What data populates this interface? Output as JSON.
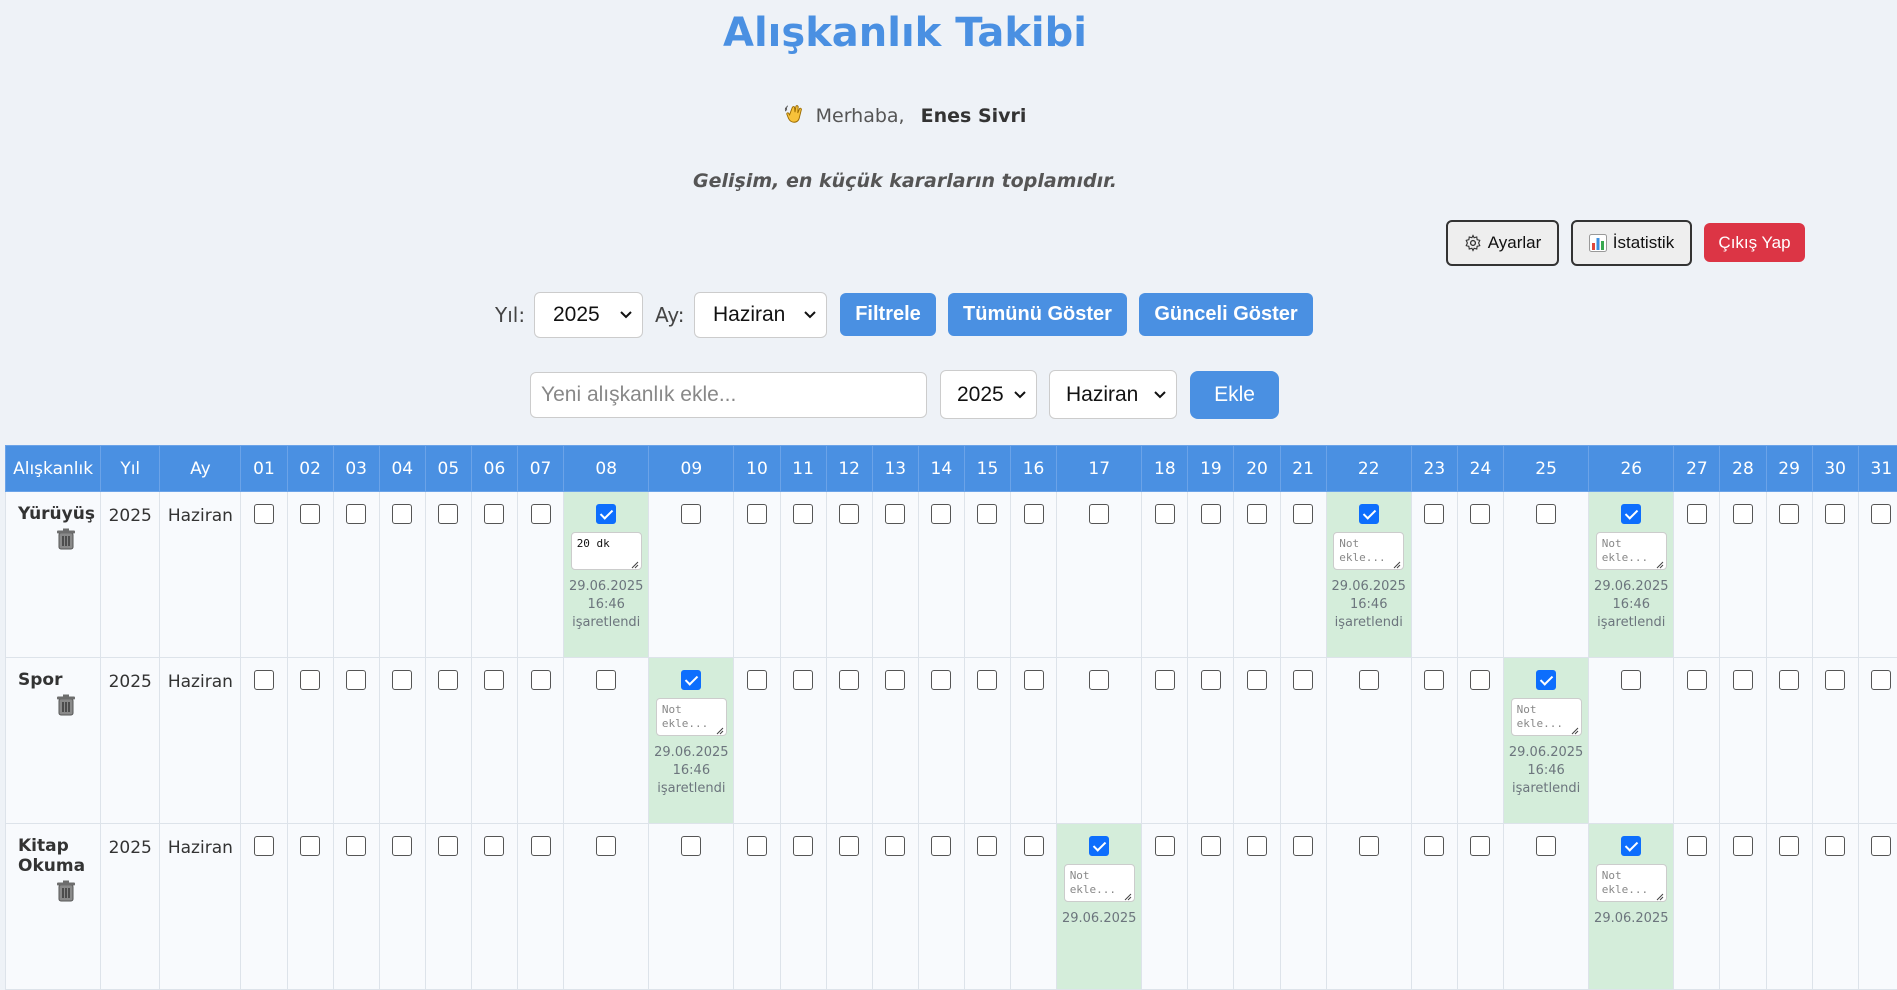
{
  "header": {
    "title": "Alışkanlık Takibi",
    "greeting": "Merhaba,",
    "user_name": "Enes Sivri",
    "quote": "Gelişim, en küçük kararların toplamıdır."
  },
  "toolbar": {
    "settings_label": "Ayarlar",
    "stats_label": "İstatistik",
    "logout_label": "Çıkış Yap"
  },
  "filter": {
    "year_label": "Yıl:",
    "year_value": "2025",
    "month_label": "Ay:",
    "month_value": "Haziran",
    "filter_label": "Filtrele",
    "show_all_label": "Tümünü Göster",
    "show_current_label": "Günceli Göster"
  },
  "add_form": {
    "placeholder": "Yeni alışkanlık ekle...",
    "year_value": "2025",
    "month_value": "Haziran",
    "add_label": "Ekle"
  },
  "table": {
    "headers": [
      "Alışkanlık",
      "Yıl",
      "Ay",
      "01",
      "02",
      "03",
      "04",
      "05",
      "06",
      "07",
      "08",
      "09",
      "10",
      "11",
      "12",
      "13",
      "14",
      "15",
      "16",
      "17",
      "18",
      "19",
      "20",
      "21",
      "22",
      "23",
      "24",
      "25",
      "26",
      "27",
      "28",
      "29",
      "30",
      "31"
    ],
    "rows": [
      {
        "habit": "Yürüyüş",
        "year": "2025",
        "month": "Haziran",
        "checked": {
          "08": {
            "note": "20 dk",
            "date": "29.06.2025",
            "time": "16:46",
            "status": "işaretlendi"
          },
          "22": {
            "note": "",
            "date": "29.06.2025",
            "time": "16:46",
            "status": "işaretlendi"
          },
          "26": {
            "note": "",
            "date": "29.06.2025",
            "time": "16:46",
            "status": "işaretlendi"
          }
        }
      },
      {
        "habit": "Spor",
        "year": "2025",
        "month": "Haziran",
        "checked": {
          "09": {
            "note": "",
            "date": "29.06.2025",
            "time": "16:46",
            "status": "işaretlendi"
          },
          "25": {
            "note": "",
            "date": "29.06.2025",
            "time": "16:46",
            "status": "işaretlendi"
          }
        }
      },
      {
        "habit": "Kitap Okuma",
        "year": "2025",
        "month": "Haziran",
        "checked": {
          "17": {
            "note": "",
            "date": "29.06.2025",
            "time": "",
            "status": ""
          },
          "26": {
            "note": "",
            "date": "29.06.2025",
            "time": "",
            "status": ""
          }
        }
      }
    ],
    "note_placeholder": "Not ekle..."
  },
  "colors": {
    "primary": "#4a90e2",
    "danger": "#dc3545",
    "checked_cell": "#d4edda",
    "background": "#eef2f7"
  }
}
